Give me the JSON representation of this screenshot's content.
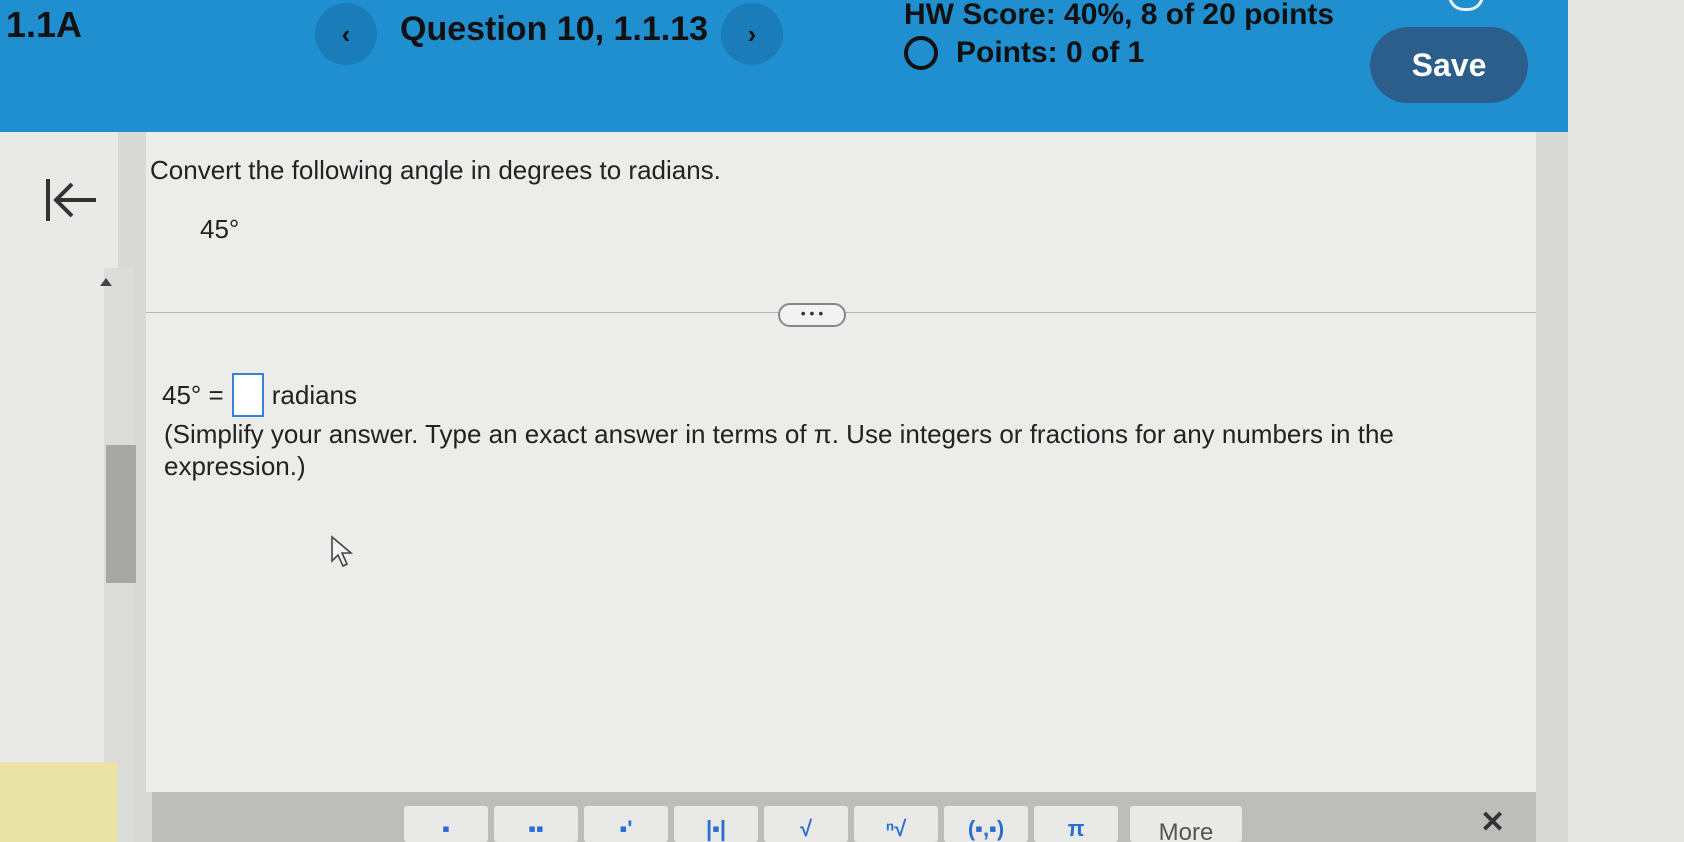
{
  "header": {
    "section": "1.1A",
    "question_title": "Question 10, 1.1.13",
    "prev_glyph": "‹",
    "next_glyph": "›",
    "hw_score": "HW Score: 40%, 8 of 20 points",
    "points": "Points: 0 of 1",
    "save_label": "Save",
    "color": "#1f8fd0"
  },
  "question": {
    "prompt": "Convert the following angle in degrees to radians.",
    "given_angle": "45°",
    "expander_label": "• • •",
    "answer_prefix": "45° =",
    "answer_value": "",
    "answer_suffix": "radians",
    "instructions": "(Simplify your answer. Type an exact answer in terms of π. Use integers or fractions for any numbers in the expression.)"
  },
  "toolbar": {
    "buttons": [
      {
        "name": "fraction-icon",
        "glyph": "▪"
      },
      {
        "name": "mixed-number-icon",
        "glyph": "▪▪"
      },
      {
        "name": "exponent-icon",
        "glyph": "▪'"
      },
      {
        "name": "absolute-value-icon",
        "glyph": "|▪|"
      },
      {
        "name": "square-root-icon",
        "glyph": "√"
      },
      {
        "name": "nth-root-icon",
        "glyph": "ⁿ√"
      },
      {
        "name": "parentheses-icon",
        "glyph": "(▪,▪)"
      },
      {
        "name": "pi-icon",
        "glyph": "π"
      }
    ],
    "more_label": "More",
    "close_glyph": "✕"
  }
}
